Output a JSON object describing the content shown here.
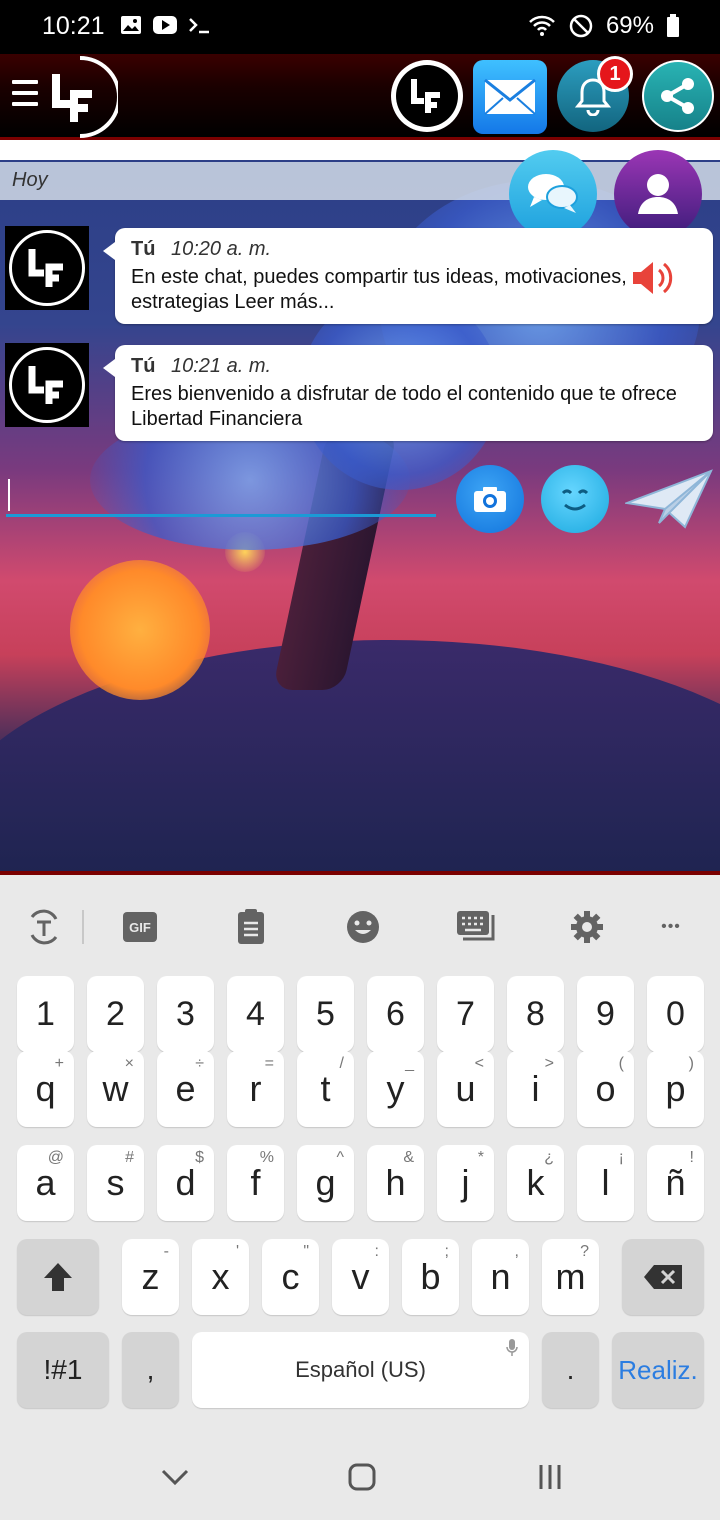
{
  "status_bar": {
    "time": "10:21",
    "battery": "69%"
  },
  "header": {
    "logo_text": "LF",
    "notification_count": "1"
  },
  "chat": {
    "day_label": "Hoy",
    "messages": [
      {
        "author": "Tú",
        "time": "10:20 a. m.",
        "text": "En este chat, puedes compartir tus ideas, motivaciones, estrategias Leer más..."
      },
      {
        "author": "Tú",
        "time": "10:21 a. m.",
        "text": "Eres bienvenido a disfrutar de todo el contenido que te ofrece Libertad Financiera"
      }
    ],
    "input_value": ""
  },
  "keyboard": {
    "numbers": [
      "1",
      "2",
      "3",
      "4",
      "5",
      "6",
      "7",
      "8",
      "9",
      "0"
    ],
    "row1": [
      {
        "k": "q",
        "h": "+"
      },
      {
        "k": "w",
        "h": "×"
      },
      {
        "k": "e",
        "h": "÷"
      },
      {
        "k": "r",
        "h": "="
      },
      {
        "k": "t",
        "h": "/"
      },
      {
        "k": "y",
        "h": "_"
      },
      {
        "k": "u",
        "h": "<"
      },
      {
        "k": "i",
        "h": ">"
      },
      {
        "k": "o",
        "h": "("
      },
      {
        "k": "p",
        "h": ")"
      }
    ],
    "row2": [
      {
        "k": "a",
        "h": "@"
      },
      {
        "k": "s",
        "h": "#"
      },
      {
        "k": "d",
        "h": "$"
      },
      {
        "k": "f",
        "h": "%"
      },
      {
        "k": "g",
        "h": "^"
      },
      {
        "k": "h",
        "h": "&"
      },
      {
        "k": "j",
        "h": "*"
      },
      {
        "k": "k",
        "h": "¿"
      },
      {
        "k": "l",
        "h": "¡"
      },
      {
        "k": "ñ",
        "h": "!"
      }
    ],
    "row3": [
      {
        "k": "z",
        "h": "-"
      },
      {
        "k": "x",
        "h": "'"
      },
      {
        "k": "c",
        "h": "\""
      },
      {
        "k": "v",
        "h": ":"
      },
      {
        "k": "b",
        "h": ";"
      },
      {
        "k": "n",
        "h": ","
      },
      {
        "k": "m",
        "h": "?"
      }
    ],
    "symbols_label": "!#1",
    "comma_label": ",",
    "space_label": "Español (US)",
    "period_label": ".",
    "action_label": "Realiz.",
    "gif_label": "GIF",
    "more_label": "•••"
  }
}
